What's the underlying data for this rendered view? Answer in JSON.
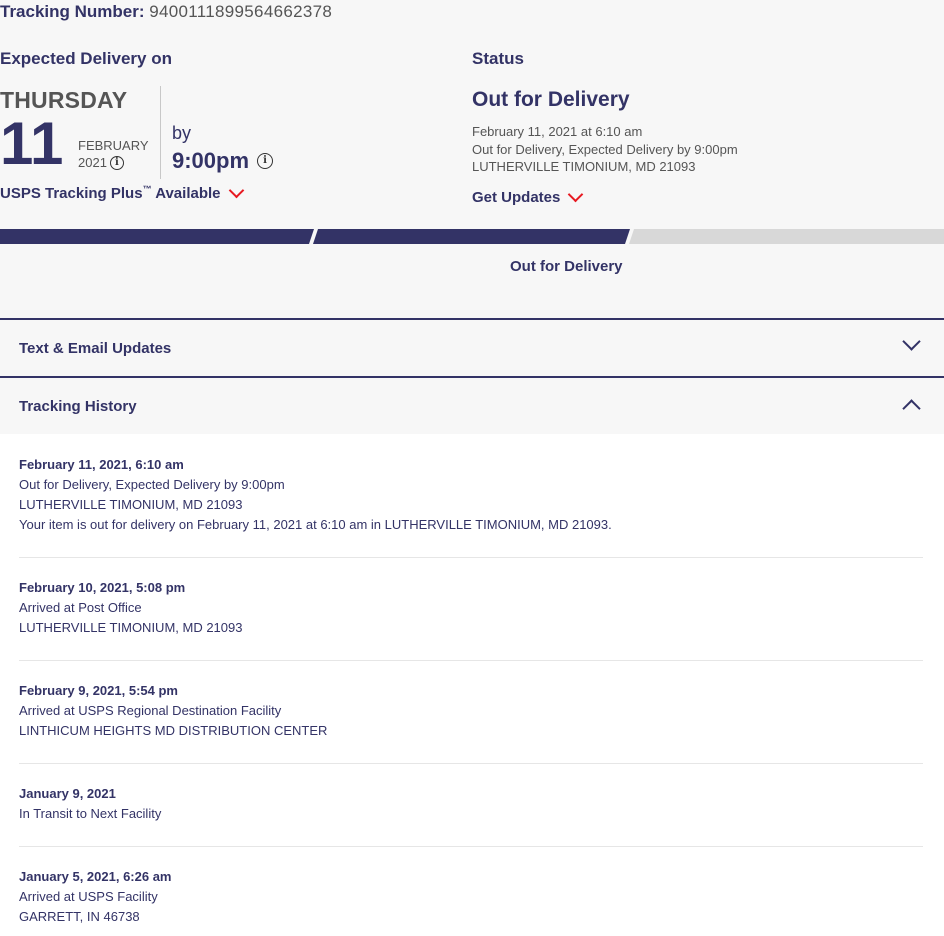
{
  "tracking": {
    "label": "Tracking Number:",
    "number": "9400111899564662378"
  },
  "expected": {
    "title": "Expected Delivery on",
    "day": "THURSDAY",
    "date": "11",
    "month": "FEBRUARY",
    "year": "2021",
    "by": "by",
    "time": "9:00pm",
    "plus_label": "USPS Tracking Plus",
    "plus_tm": "™",
    "plus_available": "Available"
  },
  "status": {
    "title": "Status",
    "main": "Out for Delivery",
    "lines": [
      "February 11, 2021 at 6:10 am",
      "Out for Delivery, Expected Delivery by 9:00pm",
      "LUTHERVILLE TIMONIUM, MD 21093"
    ],
    "get_updates": "Get Updates"
  },
  "progress": {
    "label": "Out for Delivery",
    "colors": {
      "complete": "#333366",
      "incomplete": "#d8d8d8"
    },
    "completed_segments": 2,
    "total_segments": 3
  },
  "accordions": {
    "text_email": "Text & Email Updates",
    "history": "Tracking History"
  },
  "history": [
    {
      "date": "February 11, 2021, 6:10 am",
      "lines": [
        "Out for Delivery, Expected Delivery by 9:00pm",
        "LUTHERVILLE TIMONIUM, MD 21093",
        "Your item is out for delivery on February 11, 2021 at 6:10 am in LUTHERVILLE TIMONIUM, MD 21093."
      ]
    },
    {
      "date": "February 10, 2021, 5:08 pm",
      "lines": [
        "Arrived at Post Office",
        "LUTHERVILLE TIMONIUM, MD 21093"
      ]
    },
    {
      "date": "February 9, 2021, 5:54 pm",
      "lines": [
        "Arrived at USPS Regional Destination Facility",
        "LINTHICUM HEIGHTS MD DISTRIBUTION CENTER"
      ]
    },
    {
      "date": "January 9, 2021",
      "lines": [
        "In Transit to Next Facility"
      ]
    },
    {
      "date": "January 5, 2021, 6:26 am",
      "lines": [
        "Arrived at USPS Facility",
        "GARRETT, IN 46738"
      ]
    }
  ],
  "colors": {
    "navy": "#333366",
    "red": "#e71921",
    "gray_bg": "#f7f7f7"
  },
  "icons": [
    "info-icon",
    "chevron-down-icon",
    "chevron-up-icon"
  ]
}
